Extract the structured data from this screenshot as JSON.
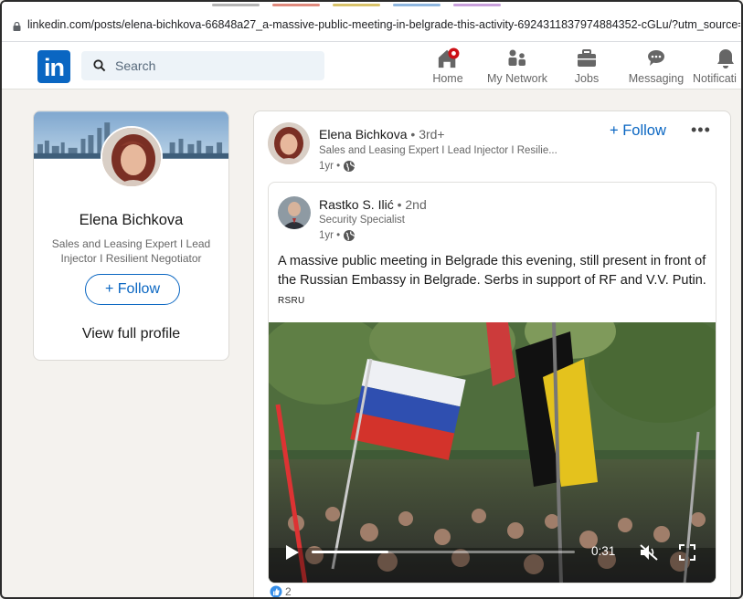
{
  "browser": {
    "url": "linkedin.com/posts/elena-bichkova-66848a27_a-massive-public-meeting-in-belgrade-this-activity-6924311837974884352-cGLu/?utm_source=sh"
  },
  "nav": {
    "search_placeholder": "Search",
    "items": [
      {
        "label": "Home",
        "icon": "home-icon"
      },
      {
        "label": "My Network",
        "icon": "network-icon"
      },
      {
        "label": "Jobs",
        "icon": "briefcase-icon"
      },
      {
        "label": "Messaging",
        "icon": "messaging-icon"
      },
      {
        "label": "Notificati",
        "icon": "bell-icon"
      }
    ],
    "brand_color": "#0a66c2"
  },
  "profile_card": {
    "name": "Elena Bichkova",
    "headline": "Sales and Leasing Expert I Lead Injector I Resilient Negotiator",
    "follow_label": "+ Follow",
    "view_profile_label": "View full profile"
  },
  "post": {
    "author": {
      "name": "Elena Bichkova",
      "degree": " • 3rd+",
      "headline": "Sales and Leasing Expert I Lead Injector I Resilie...",
      "time": "1yr •"
    },
    "follow_label": "+ Follow",
    "more_label": "•••",
    "shared": {
      "author": {
        "name": "Rastko S. Ilić",
        "degree": " • 2nd",
        "headline": "Security Specialist",
        "time": "1yr •"
      },
      "text": "A massive public meeting in Belgrade this evening, still present in front of the Russian Embassy in Belgrade. Serbs in support of RF and V.V. Putin.",
      "tag": "RSRU",
      "video": {
        "time": "0:31",
        "progress": 0.29
      }
    },
    "reactions": {
      "count": "2"
    }
  }
}
